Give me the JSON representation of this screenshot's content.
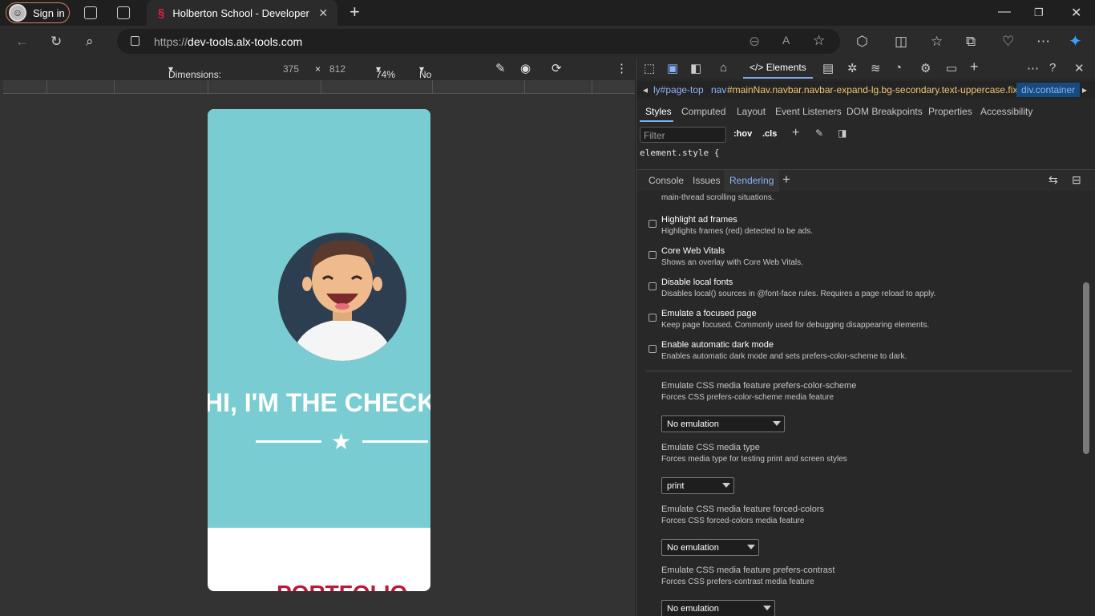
{
  "browser": {
    "sign_in": "Sign in",
    "tab_title": "Holberton School - Developer to",
    "url_protocol": "https://",
    "url_host": "dev-tools.alx-tools.com"
  },
  "device_toolbar": {
    "dimensions": "Dimensions: iPhone X",
    "width": "375",
    "times": "×",
    "height": "812",
    "zoom": "74%",
    "throttling": "No throttling"
  },
  "page": {
    "hero_title": "HI, I'M THE CHECKER",
    "section_title": "PORTFOLIO"
  },
  "devtools": {
    "elements_tab": "Elements",
    "breadcrumbs": [
      "ly#page-top",
      "nav",
      "#mainNav.navbar.navbar-expand-lg.bg-secondary.text-uppercase.fixed-top",
      "div.container"
    ],
    "panel_tabs": [
      "Styles",
      "Computed",
      "Layout",
      "Event Listeners",
      "DOM Breakpoints",
      "Properties",
      "Accessibility"
    ],
    "filter_placeholder": "Filter",
    "hov": ":hov",
    "cls": ".cls",
    "element_style": "element.style {",
    "drawer_tabs": [
      "Console",
      "Issues",
      "Rendering"
    ],
    "partial_text": "main-thread scrolling situations.",
    "options": [
      {
        "title": "Highlight ad frames",
        "desc": "Highlights frames (red) detected to be ads."
      },
      {
        "title": "Core Web Vitals",
        "desc": "Shows an overlay with Core Web Vitals."
      },
      {
        "title": "Disable local fonts",
        "desc": "Disables local() sources in @font-face rules. Requires a page reload to apply."
      },
      {
        "title": "Emulate a focused page",
        "desc": "Keep page focused. Commonly used for debugging disappearing elements."
      },
      {
        "title": "Enable automatic dark mode",
        "desc": "Enables automatic dark mode and sets prefers-color-scheme to dark."
      }
    ],
    "selects": [
      {
        "title": "Emulate CSS media feature prefers-color-scheme",
        "desc": "Forces CSS prefers-color-scheme media feature",
        "value": "No emulation"
      },
      {
        "title": "Emulate CSS media type",
        "desc": "Forces media type for testing print and screen styles",
        "value": "print"
      },
      {
        "title": "Emulate CSS media feature forced-colors",
        "desc": "Forces CSS forced-colors media feature",
        "value": "No emulation"
      },
      {
        "title": "Emulate CSS media feature prefers-contrast",
        "desc": "Forces CSS prefers-contrast media feature",
        "value": "No emulation"
      }
    ]
  }
}
